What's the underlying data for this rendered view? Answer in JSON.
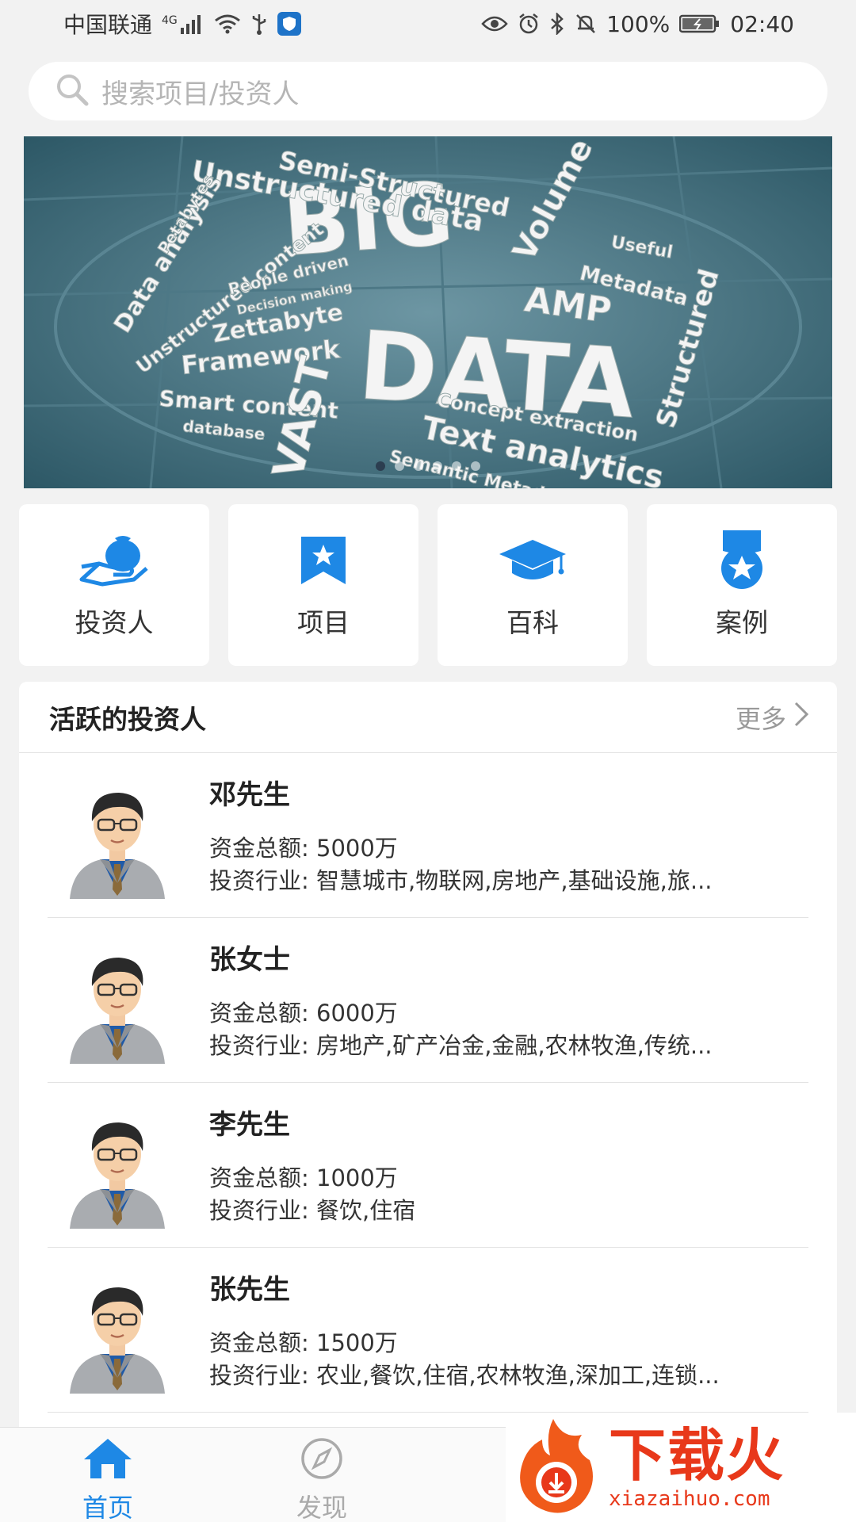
{
  "status_bar": {
    "carrier": "中国联通",
    "network": "4G",
    "battery": "100%",
    "time": "02:40"
  },
  "search": {
    "placeholder": "搜索项目/投资人"
  },
  "banner": {
    "slide_count": 6,
    "active_index": 0,
    "words": [
      "BIG",
      "DATA",
      "Semi-Structured",
      "Unstructured data",
      "Volume",
      "AMP",
      "Metadata",
      "Useful",
      "Structured",
      "Data analysis",
      "Petabytes",
      "Unstructured content",
      "People driven",
      "Decision making",
      "Zettabyte",
      "Framework",
      "Smart content",
      "database",
      "VAST",
      "Concept extraction",
      "Text analytics",
      "Semantic Metad"
    ]
  },
  "categories": [
    {
      "label": "投资人",
      "icon": "investor-money-bag-icon"
    },
    {
      "label": "项目",
      "icon": "bookmark-star-icon"
    },
    {
      "label": "百科",
      "icon": "graduation-cap-icon"
    },
    {
      "label": "案例",
      "icon": "medal-star-icon"
    }
  ],
  "active_investors": {
    "title": "活跃的投资人",
    "more": "更多",
    "items": [
      {
        "name": "邓先生",
        "amount": "资金总额: 5000万",
        "industry": "投资行业: 智慧城市,物联网,房地产,基础设施,旅..."
      },
      {
        "name": "张女士",
        "amount": "资金总额: 6000万",
        "industry": "投资行业: 房地产,矿产冶金,金融,农林牧渔,传统..."
      },
      {
        "name": "李先生",
        "amount": "资金总额: 1000万",
        "industry": "投资行业: 餐饮,住宿"
      },
      {
        "name": "张先生",
        "amount": "资金总额: 1500万",
        "industry": "投资行业: 农业,餐饮,住宿,农林牧渔,深加工,连锁..."
      }
    ]
  },
  "bottom_nav": {
    "home": "首页",
    "discover": "发现"
  },
  "watermark": {
    "cn": "下载火",
    "url": "xiazaihuo.com"
  },
  "colors": {
    "accent": "#1e88e5",
    "watermark": "#e8381a"
  }
}
